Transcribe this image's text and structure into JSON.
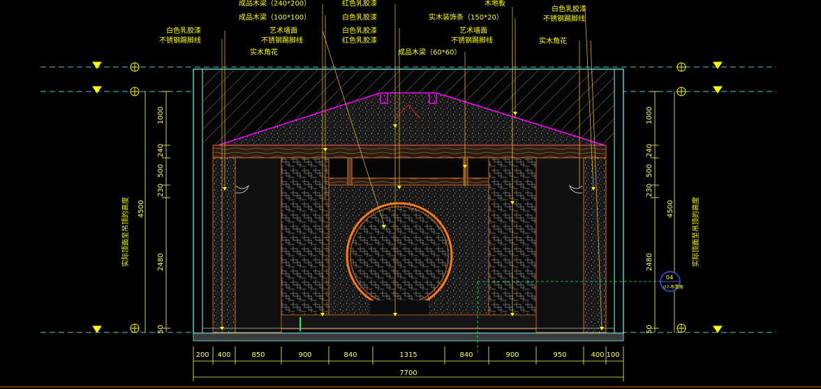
{
  "colors": {
    "background": "#000000",
    "label": "#ffff00",
    "dimension": "#ffff66",
    "frame": "#7fffff",
    "roof": "#ff00ff",
    "wood": "#d2691e",
    "moon_gate": "#ff7a1a",
    "leader": "#e0b030",
    "level_line": "#3fd3d3",
    "section_mark": "#3a5bff",
    "green_ref": "#00ff66"
  },
  "annotations_left": {
    "beam_240x200": "成品木梁（240*200）",
    "beam_100x100": "成品木梁（100*100）",
    "white_latex_paint": "白色乳胶漆",
    "steel_skirting": "不锈钢踢脚线",
    "art_wall": "艺术墙面",
    "steel_skirting_2": "不锈钢踢脚线",
    "wood_corner_flower": "实木角花"
  },
  "annotations_center": {
    "red_latex_1": "红色乳胶漆",
    "white_latex_1": "白色乳胶漆",
    "white_latex_2": "白色乳胶漆",
    "red_latex_2": "红色乳胶漆",
    "beam_60x60": "成品木梁（60*60）"
  },
  "annotations_right": {
    "wood_floor": "木地板",
    "wood_trim": "实木装饰条（150*20）",
    "art_wall": "艺术墙面",
    "steel_skirting": "不锈钢踢脚线",
    "white_latex": "白色乳胶漆",
    "steel_skirting_2": "不锈钢踢脚线",
    "wood_corner_flower": "实木角花"
  },
  "vertical_dims": {
    "segments": [
      "1000",
      "240",
      "500",
      "230",
      "2480",
      "50"
    ],
    "total": "4500",
    "note": "实际顶面至吊顶的高度"
  },
  "horizontal_dims": {
    "segments": [
      "200",
      "400",
      "850",
      "900",
      "840",
      "1315",
      "840",
      "900",
      "950",
      "400",
      "100"
    ],
    "total": "7700"
  },
  "section_marker": {
    "number": "04",
    "sheet": "D7-布置图"
  }
}
